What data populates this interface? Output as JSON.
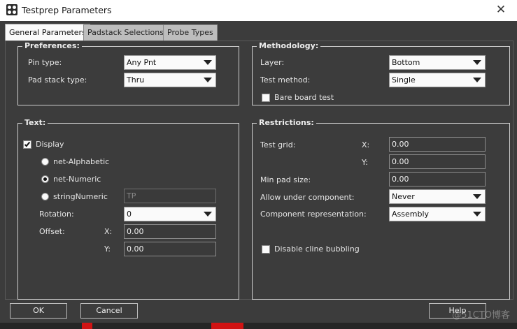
{
  "window": {
    "title": "Testprep Parameters"
  },
  "tabs": [
    {
      "label": "General Parameters",
      "active": true
    },
    {
      "label": "Padstack Selections",
      "active": false
    },
    {
      "label": "Probe Types",
      "active": false
    }
  ],
  "preferences": {
    "title": "Preferences:",
    "pin_type": {
      "label": "Pin type:",
      "value": "Any Pnt"
    },
    "pad_stack_type": {
      "label": "Pad stack type:",
      "value": "Thru"
    }
  },
  "methodology": {
    "title": "Methodology:",
    "layer": {
      "label": "Layer:",
      "value": "Bottom"
    },
    "test_method": {
      "label": "Test method:",
      "value": "Single"
    },
    "bare_board_test": {
      "label": "Bare board test",
      "checked": false
    }
  },
  "text": {
    "title": "Text:",
    "display": {
      "label": "Display",
      "checked": true
    },
    "options": [
      {
        "label": "net-Alphabetic",
        "selected": false
      },
      {
        "label": "net-Numeric",
        "selected": true
      },
      {
        "label": "stringNumeric",
        "selected": false
      }
    ],
    "string_value": "TP",
    "rotation": {
      "label": "Rotation:",
      "value": "0"
    },
    "offset": {
      "label": "Offset:",
      "x_label": "X:",
      "x_value": "0.00",
      "y_label": "Y:",
      "y_value": "0.00"
    }
  },
  "restrictions": {
    "title": "Restrictions:",
    "test_grid": {
      "label": "Test grid:",
      "x_label": "X:",
      "x_value": "0.00",
      "y_label": "Y:",
      "y_value": "0.00"
    },
    "min_pad_size": {
      "label": "Min pad size:",
      "value": "0.00"
    },
    "allow_under_component": {
      "label": "Allow under component:",
      "value": "Never"
    },
    "component_representation": {
      "label": "Component representation:",
      "value": "Assembly"
    },
    "disable_cline_bubbling": {
      "label": "Disable cline bubbling",
      "checked": false
    }
  },
  "buttons": {
    "ok": "OK",
    "cancel": "Cancel",
    "help": "Help"
  },
  "watermark": "@51CTO博客",
  "icons": {
    "close": "close-icon",
    "app": "app-icon",
    "dropdown": "chevron-down-icon"
  }
}
